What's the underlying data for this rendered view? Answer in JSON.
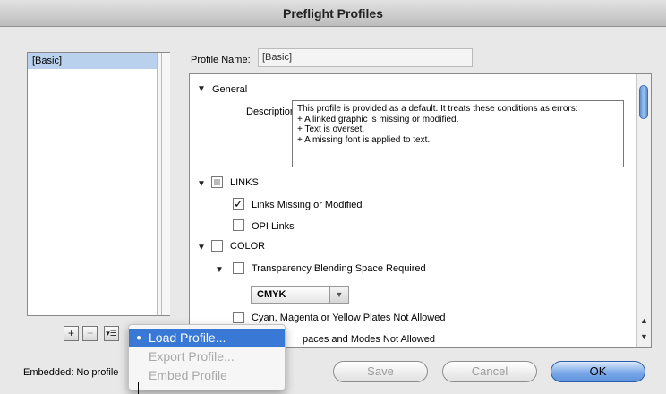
{
  "window": {
    "title": "Preflight Profiles"
  },
  "profiles": {
    "items": [
      "[Basic]"
    ]
  },
  "profile_name": {
    "label": "Profile Name:",
    "value": "[Basic]"
  },
  "tree": {
    "general": {
      "label": "General"
    },
    "description": {
      "label": "Description:",
      "text": "This profile is provided as a default. It treats these conditions as errors:\n+ A linked graphic is missing or modified.\n+ Text is overset.\n+ A missing font is applied to text."
    },
    "links": {
      "label": "LINKS",
      "children": [
        "Links Missing or Modified",
        "OPI Links"
      ],
      "checked": [
        true,
        false
      ]
    },
    "color": {
      "label": "COLOR"
    },
    "transparency": {
      "label": "Transparency Blending Space Required"
    },
    "blend_select": {
      "value": "CMYK"
    },
    "cmy_plates": {
      "label": "Cyan, Magenta or Yellow Plates Not Allowed"
    },
    "color_spaces": {
      "label": "Color Spaces and Modes Not Allowed",
      "visible_fragment": "paces and Modes Not Allowed"
    }
  },
  "bottom": {
    "embedded": "Embedded: No profile"
  },
  "buttons": {
    "save": "Save",
    "cancel": "Cancel",
    "ok": "OK"
  },
  "icons": {
    "add": "+",
    "remove": "−",
    "menu": "▾☰"
  },
  "popup_menu": {
    "items": [
      {
        "label": "Load Profile...",
        "enabled": true,
        "highlighted": true
      },
      {
        "label": "Export Profile...",
        "enabled": false
      },
      {
        "label": "Embed Profile",
        "enabled": false
      }
    ]
  },
  "colors": {
    "accent": "#3a78d6",
    "selection": "#b9d1ec"
  }
}
